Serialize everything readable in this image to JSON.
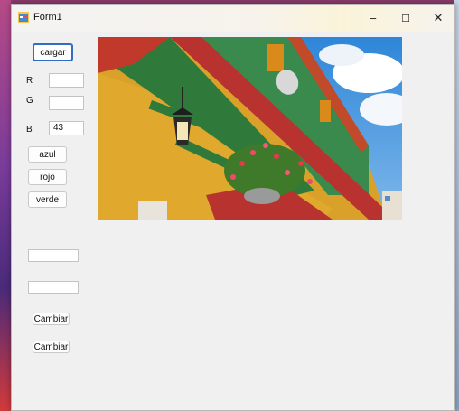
{
  "window": {
    "title": "Form1",
    "minimize": "−",
    "maximize": "☐",
    "close": "✕"
  },
  "buttons": {
    "cargar": "cargar",
    "azul": "azul",
    "rojo": "rojo",
    "verde": "verde",
    "cambiar1": "Cambiar",
    "cambiar2": "Cambiar"
  },
  "labels": {
    "r": "R",
    "g": "G",
    "b": "B"
  },
  "inputs": {
    "r_value": "",
    "g_value": "",
    "b_value": "43",
    "text1_value": "",
    "text2_value": ""
  },
  "icons": {
    "app": "form-app-icon",
    "photo": "colorful-building-photo",
    "lamp": "lantern-icon",
    "flowers": "hanging-flower-basket-icon"
  }
}
